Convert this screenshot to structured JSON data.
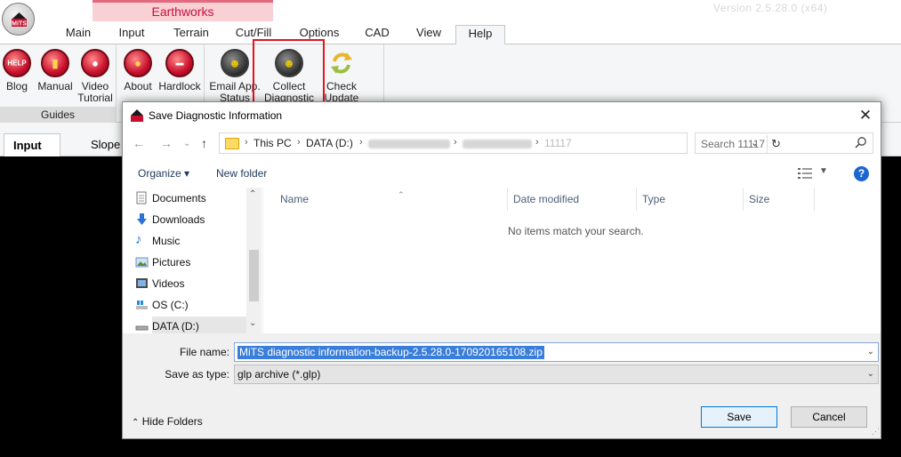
{
  "app": {
    "context_group": "Earthworks",
    "version_text": "Version 2.5.28.0 (x64)",
    "tabs": [
      "Main",
      "Input",
      "Terrain",
      "Cut/Fill",
      "Options",
      "CAD",
      "View",
      "Help"
    ],
    "active_tab": "Help",
    "ribbon": {
      "guides_group_label": "Guides",
      "buttons": {
        "blog": "Blog",
        "manual": "Manual",
        "video_l1": "Video",
        "video_l2": "Tutorial",
        "about": "About",
        "hardlock": "Hardlock",
        "email_l1": "Email App.",
        "email_l2": "Status",
        "collect_l1": "Collect",
        "collect_l2": "Diagnostic",
        "check_l1": "Check",
        "check_l2": "Update"
      }
    },
    "subtabs": [
      "Input",
      "Slope C"
    ],
    "accent_red": "#e3141d"
  },
  "dialog": {
    "title": "Save Diagnostic Information",
    "address": {
      "segments": [
        "This PC",
        "DATA (D:)"
      ],
      "last_folder": "11117"
    },
    "search_placeholder": "Search 11117",
    "toolbar": {
      "organize": "Organize ▾",
      "new_folder": "New folder"
    },
    "nav_items": [
      {
        "label": "Documents",
        "icon": "documents-icon"
      },
      {
        "label": "Downloads",
        "icon": "downloads-icon"
      },
      {
        "label": "Music",
        "icon": "music-icon"
      },
      {
        "label": "Pictures",
        "icon": "pictures-icon"
      },
      {
        "label": "Videos",
        "icon": "videos-icon"
      },
      {
        "label": "OS (C:)",
        "icon": "drive-c-icon"
      },
      {
        "label": "DATA (D:)",
        "icon": "drive-d-icon"
      }
    ],
    "columns": [
      "Name",
      "Date modified",
      "Type",
      "Size"
    ],
    "empty_message": "No items match your search.",
    "file_name_label": "File name:",
    "file_name_value": "MiTS diagnostic information-backup-2.5.28.0-170920165108.zip",
    "save_as_label": "Save as type:",
    "save_as_value": "glp archive (*.glp)",
    "hide_folders": "Hide Folders",
    "save_button": "Save",
    "cancel_button": "Cancel"
  }
}
